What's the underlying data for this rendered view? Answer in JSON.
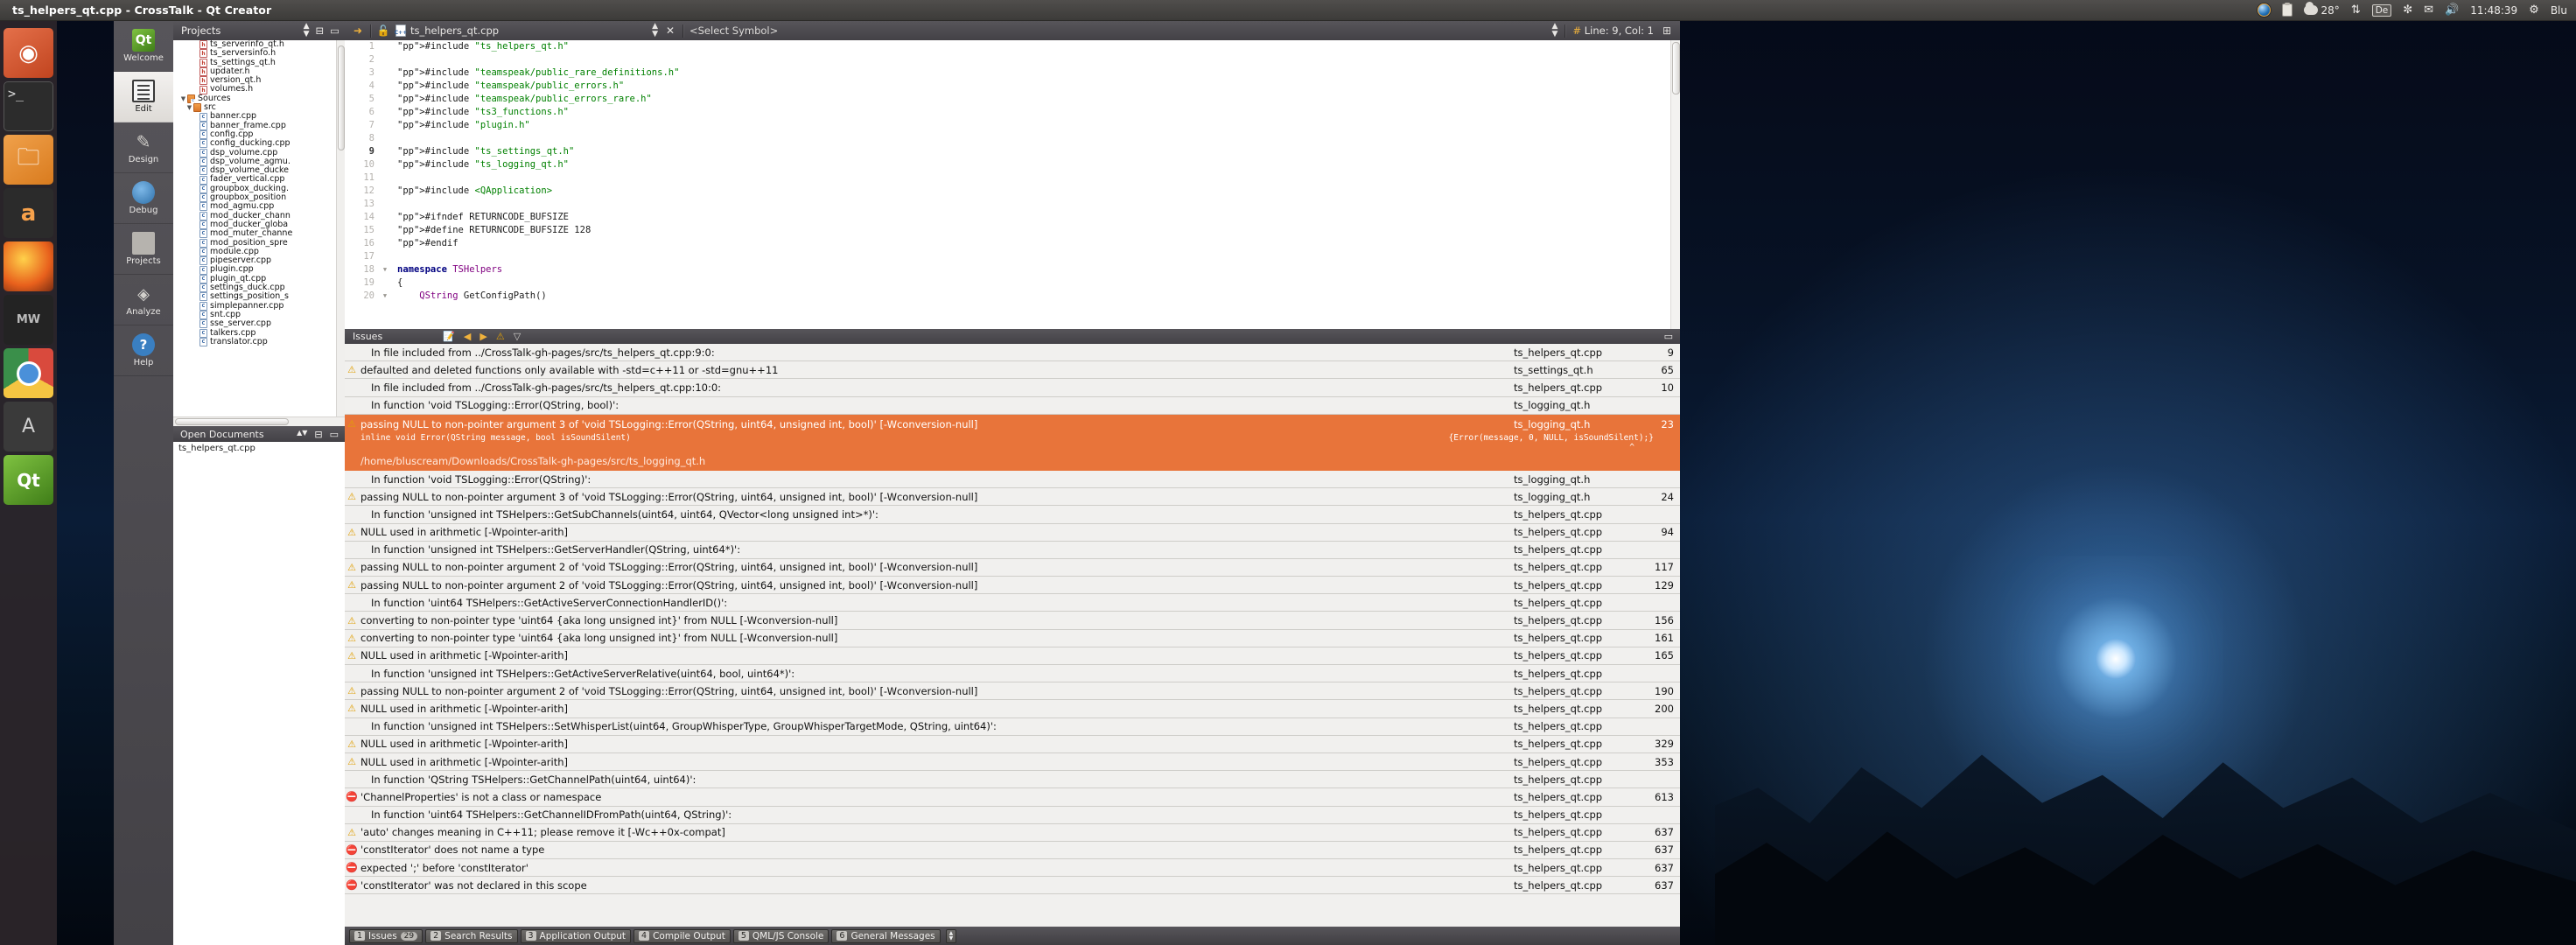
{
  "window": {
    "title": "ts_helpers_qt.cpp - CrossTalk - Qt Creator"
  },
  "tray": {
    "temperature": "28°",
    "keyboard_layout": "De",
    "clock": "11:48:39",
    "user": "Blu"
  },
  "launcher": {
    "items": [
      {
        "name": "dash-icon",
        "glyph": "◉"
      },
      {
        "name": "terminal-icon",
        "glyph": ">_"
      },
      {
        "name": "files-icon",
        "glyph": "🗀"
      },
      {
        "name": "amazon-icon",
        "glyph": "a"
      },
      {
        "name": "firefox-icon",
        "glyph": ""
      },
      {
        "name": "mediawiki-icon",
        "glyph": "MW"
      },
      {
        "name": "chromium-icon",
        "glyph": ""
      },
      {
        "name": "texteditor-icon",
        "glyph": "A"
      },
      {
        "name": "qtcreator-icon",
        "glyph": "Qt"
      }
    ]
  },
  "modes": [
    {
      "label": "Welcome",
      "icon": "qt"
    },
    {
      "label": "Edit",
      "icon": "edit"
    },
    {
      "label": "Design",
      "icon": "design"
    },
    {
      "label": "Debug",
      "icon": "debug"
    },
    {
      "label": "Projects",
      "icon": "proj"
    },
    {
      "label": "Analyze",
      "icon": "analyze"
    },
    {
      "label": "Help",
      "icon": "help"
    }
  ],
  "sidebar": {
    "projects_title": "Projects",
    "open_documents_title": "Open Documents",
    "open_documents": [
      "ts_helpers_qt.cpp"
    ],
    "tree": [
      {
        "label": "ts_serverinfo_qt.h",
        "icon": "h",
        "indent": 3
      },
      {
        "label": "ts_serversinfo.h",
        "icon": "h",
        "indent": 3
      },
      {
        "label": "ts_settings_qt.h",
        "icon": "h",
        "indent": 3
      },
      {
        "label": "updater.h",
        "icon": "h",
        "indent": 3
      },
      {
        "label": "version_qt.h",
        "icon": "h",
        "indent": 3
      },
      {
        "label": "volumes.h",
        "icon": "h",
        "indent": 3
      },
      {
        "label": "Sources",
        "icon": "folderc",
        "indent": 1,
        "arrow": "▼"
      },
      {
        "label": "src",
        "icon": "folder",
        "indent": 2,
        "arrow": "▼"
      },
      {
        "label": "banner.cpp",
        "icon": "cpp",
        "indent": 3
      },
      {
        "label": "banner_frame.cpp",
        "icon": "cpp",
        "indent": 3
      },
      {
        "label": "config.cpp",
        "icon": "cpp",
        "indent": 3
      },
      {
        "label": "config_ducking.cpp",
        "icon": "cpp",
        "indent": 3
      },
      {
        "label": "dsp_volume.cpp",
        "icon": "cpp",
        "indent": 3
      },
      {
        "label": "dsp_volume_agmu.",
        "icon": "cpp",
        "indent": 3
      },
      {
        "label": "dsp_volume_ducke",
        "icon": "cpp",
        "indent": 3
      },
      {
        "label": "fader_vertical.cpp",
        "icon": "cpp",
        "indent": 3
      },
      {
        "label": "groupbox_ducking.",
        "icon": "cpp",
        "indent": 3
      },
      {
        "label": "groupbox_position",
        "icon": "cpp",
        "indent": 3
      },
      {
        "label": "mod_agmu.cpp",
        "icon": "cpp",
        "indent": 3
      },
      {
        "label": "mod_ducker_chann",
        "icon": "cpp",
        "indent": 3
      },
      {
        "label": "mod_ducker_globa",
        "icon": "cpp",
        "indent": 3
      },
      {
        "label": "mod_muter_channe",
        "icon": "cpp",
        "indent": 3
      },
      {
        "label": "mod_position_spre",
        "icon": "cpp",
        "indent": 3
      },
      {
        "label": "module.cpp",
        "icon": "cpp",
        "indent": 3
      },
      {
        "label": "pipeserver.cpp",
        "icon": "cpp",
        "indent": 3
      },
      {
        "label": "plugin.cpp",
        "icon": "cpp",
        "indent": 3
      },
      {
        "label": "plugin_qt.cpp",
        "icon": "cpp",
        "indent": 3
      },
      {
        "label": "settings_duck.cpp",
        "icon": "cpp",
        "indent": 3
      },
      {
        "label": "settings_position_s",
        "icon": "cpp",
        "indent": 3
      },
      {
        "label": "simplepanner.cpp",
        "icon": "cpp",
        "indent": 3
      },
      {
        "label": "snt.cpp",
        "icon": "cpp",
        "indent": 3
      },
      {
        "label": "sse_server.cpp",
        "icon": "cpp",
        "indent": 3
      },
      {
        "label": "talkers.cpp",
        "icon": "cpp",
        "indent": 3
      },
      {
        "label": "translator.cpp",
        "icon": "cpp",
        "indent": 3
      }
    ]
  },
  "editor_toolbar": {
    "filename": "ts_helpers_qt.cpp",
    "symbol": "<Select Symbol>",
    "position": "Line: 9, Col: 1",
    "hash": "#"
  },
  "editor": {
    "lines": [
      {
        "n": "1",
        "code": "#include \"ts_helpers_qt.h\"",
        "fold": ""
      },
      {
        "n": "2",
        "code": "",
        "fold": ""
      },
      {
        "n": "3",
        "code": "#include \"teamspeak/public_rare_definitions.h\"",
        "fold": ""
      },
      {
        "n": "4",
        "code": "#include \"teamspeak/public_errors.h\"",
        "fold": ""
      },
      {
        "n": "5",
        "code": "#include \"teamspeak/public_errors_rare.h\"",
        "fold": ""
      },
      {
        "n": "6",
        "code": "#include \"ts3_functions.h\"",
        "fold": ""
      },
      {
        "n": "7",
        "code": "#include \"plugin.h\"",
        "fold": ""
      },
      {
        "n": "8",
        "code": "",
        "fold": ""
      },
      {
        "n": "9",
        "code": "#include \"ts_settings_qt.h\"",
        "fold": "",
        "current": true
      },
      {
        "n": "10",
        "code": "#include \"ts_logging_qt.h\"",
        "fold": ""
      },
      {
        "n": "11",
        "code": "",
        "fold": ""
      },
      {
        "n": "12",
        "code": "#include <QApplication>",
        "fold": ""
      },
      {
        "n": "13",
        "code": "",
        "fold": ""
      },
      {
        "n": "14",
        "code": "#ifndef RETURNCODE_BUFSIZE",
        "fold": ""
      },
      {
        "n": "15",
        "code": "#define RETURNCODE_BUFSIZE 128",
        "fold": ""
      },
      {
        "n": "16",
        "code": "#endif",
        "fold": ""
      },
      {
        "n": "17",
        "code": "",
        "fold": ""
      },
      {
        "n": "18",
        "code": "namespace TSHelpers",
        "fold": "▼"
      },
      {
        "n": "19",
        "code": "{",
        "fold": ""
      },
      {
        "n": "20",
        "code": "    QString GetConfigPath()",
        "fold": "▼"
      }
    ]
  },
  "issues": {
    "title": "Issues",
    "rows": [
      {
        "icon": "",
        "text": "In file included from ../CrossTalk-gh-pages/src/ts_helpers_qt.cpp:9:0:",
        "file": "ts_helpers_qt.cpp",
        "line": "9",
        "indent": true
      },
      {
        "icon": "warning",
        "text": "defaulted and deleted functions only available with -std=c++11 or -std=gnu++11",
        "file": "ts_settings_qt.h",
        "line": "65"
      },
      {
        "icon": "",
        "text": "In file included from ../CrossTalk-gh-pages/src/ts_helpers_qt.cpp:10:0:",
        "file": "ts_helpers_qt.cpp",
        "line": "10",
        "indent": true
      },
      {
        "icon": "",
        "text": "In function 'void TSLogging::Error(QString, bool)':",
        "file": "ts_logging_qt.h",
        "line": "",
        "indent": true
      },
      {
        "icon": "warning",
        "text": "passing NULL to non-pointer argument 3 of 'void TSLogging::Error(QString, uint64, unsigned int, bool)' [-Wconversion-null]",
        "file": "ts_logging_qt.h",
        "line": "23",
        "selected": true,
        "code_left": "inline void Error(QString message, bool isSoundSilent)",
        "code_right": "{Error(message, 0, NULL, isSoundSilent);}",
        "caret": "^",
        "path": "/home/bluscream/Downloads/CrossTalk-gh-pages/src/ts_logging_qt.h"
      },
      {
        "icon": "",
        "text": "In function 'void TSLogging::Error(QString)':",
        "file": "ts_logging_qt.h",
        "line": "",
        "indent": true
      },
      {
        "icon": "warning",
        "text": "passing NULL to non-pointer argument 3 of 'void TSLogging::Error(QString, uint64, unsigned int, bool)' [-Wconversion-null]",
        "file": "ts_logging_qt.h",
        "line": "24"
      },
      {
        "icon": "",
        "text": "In function 'unsigned int TSHelpers::GetSubChannels(uint64, uint64, QVector<long unsigned int>*)':",
        "file": "ts_helpers_qt.cpp",
        "line": "",
        "indent": true
      },
      {
        "icon": "warning",
        "text": "NULL used in arithmetic [-Wpointer-arith]",
        "file": "ts_helpers_qt.cpp",
        "line": "94"
      },
      {
        "icon": "",
        "text": "In function 'unsigned int TSHelpers::GetServerHandler(QString, uint64*)':",
        "file": "ts_helpers_qt.cpp",
        "line": "",
        "indent": true
      },
      {
        "icon": "warning",
        "text": "passing NULL to non-pointer argument 2 of 'void TSLogging::Error(QString, uint64, unsigned int, bool)' [-Wconversion-null]",
        "file": "ts_helpers_qt.cpp",
        "line": "117"
      },
      {
        "icon": "warning",
        "text": "passing NULL to non-pointer argument 2 of 'void TSLogging::Error(QString, uint64, unsigned int, bool)' [-Wconversion-null]",
        "file": "ts_helpers_qt.cpp",
        "line": "129"
      },
      {
        "icon": "",
        "text": "In function 'uint64 TSHelpers::GetActiveServerConnectionHandlerID()':",
        "file": "ts_helpers_qt.cpp",
        "line": "",
        "indent": true
      },
      {
        "icon": "warning",
        "text": "converting to non-pointer type 'uint64 {aka long unsigned int}' from NULL [-Wconversion-null]",
        "file": "ts_helpers_qt.cpp",
        "line": "156"
      },
      {
        "icon": "warning",
        "text": "converting to non-pointer type 'uint64 {aka long unsigned int}' from NULL [-Wconversion-null]",
        "file": "ts_helpers_qt.cpp",
        "line": "161"
      },
      {
        "icon": "warning",
        "text": "NULL used in arithmetic [-Wpointer-arith]",
        "file": "ts_helpers_qt.cpp",
        "line": "165"
      },
      {
        "icon": "",
        "text": "In function 'unsigned int TSHelpers::GetActiveServerRelative(uint64, bool, uint64*)':",
        "file": "ts_helpers_qt.cpp",
        "line": "",
        "indent": true
      },
      {
        "icon": "warning",
        "text": "passing NULL to non-pointer argument 2 of 'void TSLogging::Error(QString, uint64, unsigned int, bool)' [-Wconversion-null]",
        "file": "ts_helpers_qt.cpp",
        "line": "190"
      },
      {
        "icon": "warning",
        "text": "NULL used in arithmetic [-Wpointer-arith]",
        "file": "ts_helpers_qt.cpp",
        "line": "200"
      },
      {
        "icon": "",
        "text": "In function 'unsigned int TSHelpers::SetWhisperList(uint64, GroupWhisperType, GroupWhisperTargetMode, QString, uint64)':",
        "file": "ts_helpers_qt.cpp",
        "line": "",
        "indent": true
      },
      {
        "icon": "warning",
        "text": "NULL used in arithmetic [-Wpointer-arith]",
        "file": "ts_helpers_qt.cpp",
        "line": "329"
      },
      {
        "icon": "warning",
        "text": "NULL used in arithmetic [-Wpointer-arith]",
        "file": "ts_helpers_qt.cpp",
        "line": "353"
      },
      {
        "icon": "",
        "text": "In function 'QString TSHelpers::GetChannelPath(uint64, uint64)':",
        "file": "ts_helpers_qt.cpp",
        "line": "",
        "indent": true
      },
      {
        "icon": "error",
        "text": "'ChannelProperties' is not a class or namespace",
        "file": "ts_helpers_qt.cpp",
        "line": "613"
      },
      {
        "icon": "",
        "text": "In function 'uint64 TSHelpers::GetChannelIDFromPath(uint64, QString)':",
        "file": "ts_helpers_qt.cpp",
        "line": "",
        "indent": true
      },
      {
        "icon": "warning",
        "text": "'auto' changes meaning in C++11; please remove it [-Wc++0x-compat]",
        "file": "ts_helpers_qt.cpp",
        "line": "637"
      },
      {
        "icon": "error",
        "text": "'constIterator' does not name a type",
        "file": "ts_helpers_qt.cpp",
        "line": "637"
      },
      {
        "icon": "error",
        "text": "expected ';' before 'constIterator'",
        "file": "ts_helpers_qt.cpp",
        "line": "637"
      },
      {
        "icon": "error",
        "text": "'constIterator' was not declared in this scope",
        "file": "ts_helpers_qt.cpp",
        "line": "637"
      }
    ]
  },
  "output_tabs": [
    {
      "num": "1",
      "label": "Issues",
      "badge": "29"
    },
    {
      "num": "2",
      "label": "Search Results",
      "badge": ""
    },
    {
      "num": "3",
      "label": "Application Output",
      "badge": ""
    },
    {
      "num": "4",
      "label": "Compile Output",
      "badge": ""
    },
    {
      "num": "5",
      "label": "QML/JS Console",
      "badge": ""
    },
    {
      "num": "6",
      "label": "General Messages",
      "badge": ""
    }
  ],
  "colors": {
    "selection": "#e8743a",
    "warning": "#e0a008",
    "error": "#cc2222",
    "toolbar": "#4a484d"
  }
}
